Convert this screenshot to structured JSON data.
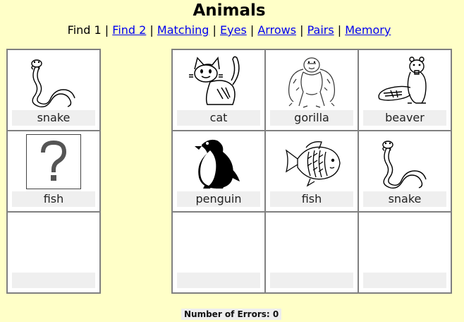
{
  "header": {
    "title": "Animals"
  },
  "nav": {
    "current": "Find 1",
    "links": [
      "Find 2",
      "Matching",
      "Eyes",
      "Arrows",
      "Pairs",
      "Memory"
    ],
    "separator": " | "
  },
  "left_panel": {
    "cells": [
      {
        "icon": "snake-icon",
        "label": "snake"
      },
      {
        "icon": "question-mark-icon",
        "label": "fish"
      },
      {
        "icon": "",
        "label": ""
      }
    ]
  },
  "right_panel": {
    "cells": [
      {
        "icon": "cat-icon",
        "label": "cat"
      },
      {
        "icon": "gorilla-icon",
        "label": "gorilla"
      },
      {
        "icon": "beaver-icon",
        "label": "beaver"
      },
      {
        "icon": "penguin-icon",
        "label": "penguin"
      },
      {
        "icon": "fish-icon",
        "label": "fish"
      },
      {
        "icon": "snake-icon",
        "label": "snake"
      },
      {
        "icon": "",
        "label": ""
      },
      {
        "icon": "",
        "label": ""
      },
      {
        "icon": "",
        "label": ""
      }
    ]
  },
  "status": {
    "errors_label": "Number of Errors: 0"
  }
}
